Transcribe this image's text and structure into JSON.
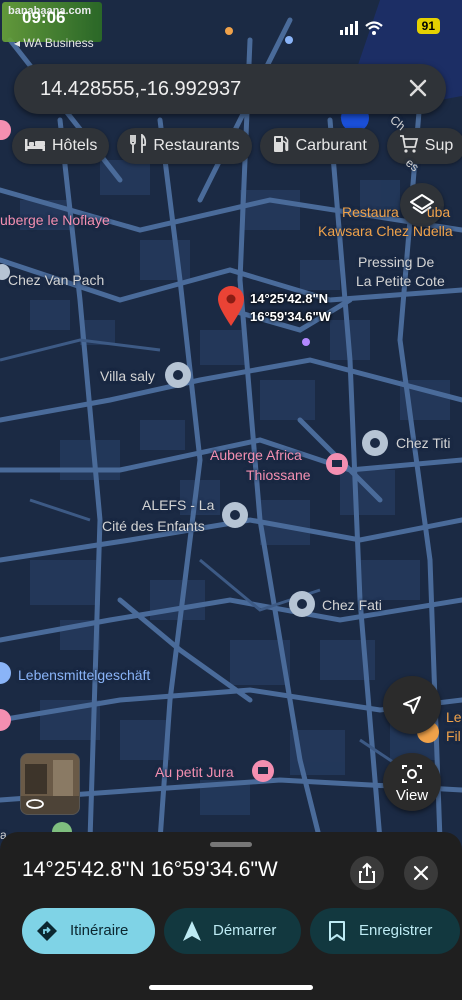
{
  "status": {
    "time": "09:06",
    "back_label": "◂ WA Business",
    "battery": "91",
    "watermark": "banabaana.com"
  },
  "search": {
    "query": "14.428555,-16.992937"
  },
  "chips": [
    {
      "label": "Hôtels",
      "icon": "bed-icon"
    },
    {
      "label": "Restaurants",
      "icon": "fork-knife-icon"
    },
    {
      "label": "Carburant",
      "icon": "fuel-pump-icon"
    },
    {
      "label": "Sup",
      "icon": "cart-icon"
    }
  ],
  "map": {
    "pin_label_line1": "14°25'42.8\"N",
    "pin_label_line2": "16°59'34.6\"W",
    "places": {
      "auberge_noflaye": "uberge le Noflaye",
      "restaurant_1": "Restaura",
      "restaurant_1b": "uba",
      "kawsara": "Kawsara Chez Ndella",
      "chez_van_pach": "Chez Van Pach",
      "pressing_1": "Pressing De",
      "pressing_2": "La Petite Cote",
      "villa_saly": "Villa saly",
      "chez_titi": "Chez Titi",
      "auberge_africa_1": "Auberge Africa",
      "auberge_africa_2": "Thiossane",
      "alefs_1": "ALEFS - La",
      "alefs_2": "Cité des Enfants",
      "chez_fati": "Chez Fati",
      "lebensmittel": "Lebensmittelgeschäft",
      "au_petit_jura": "Au petit Jura",
      "right_le": "Le",
      "right_fil": "Fil",
      "road_frag": "Ch",
      "road_frag2": "es",
      "left_frag": "a"
    },
    "colors": {
      "background": "#1b2a44",
      "road": "#4a6b9a",
      "building": "#24395c",
      "pin": "#ea4335"
    }
  },
  "controls": {
    "view_label": "View"
  },
  "sheet": {
    "title": "14°25'42.8\"N 16°59'34.6\"W",
    "itinerary": "Itinéraire",
    "start": "Démarrer",
    "save": "Enregistrer",
    "accent": "#7fd3e6"
  }
}
